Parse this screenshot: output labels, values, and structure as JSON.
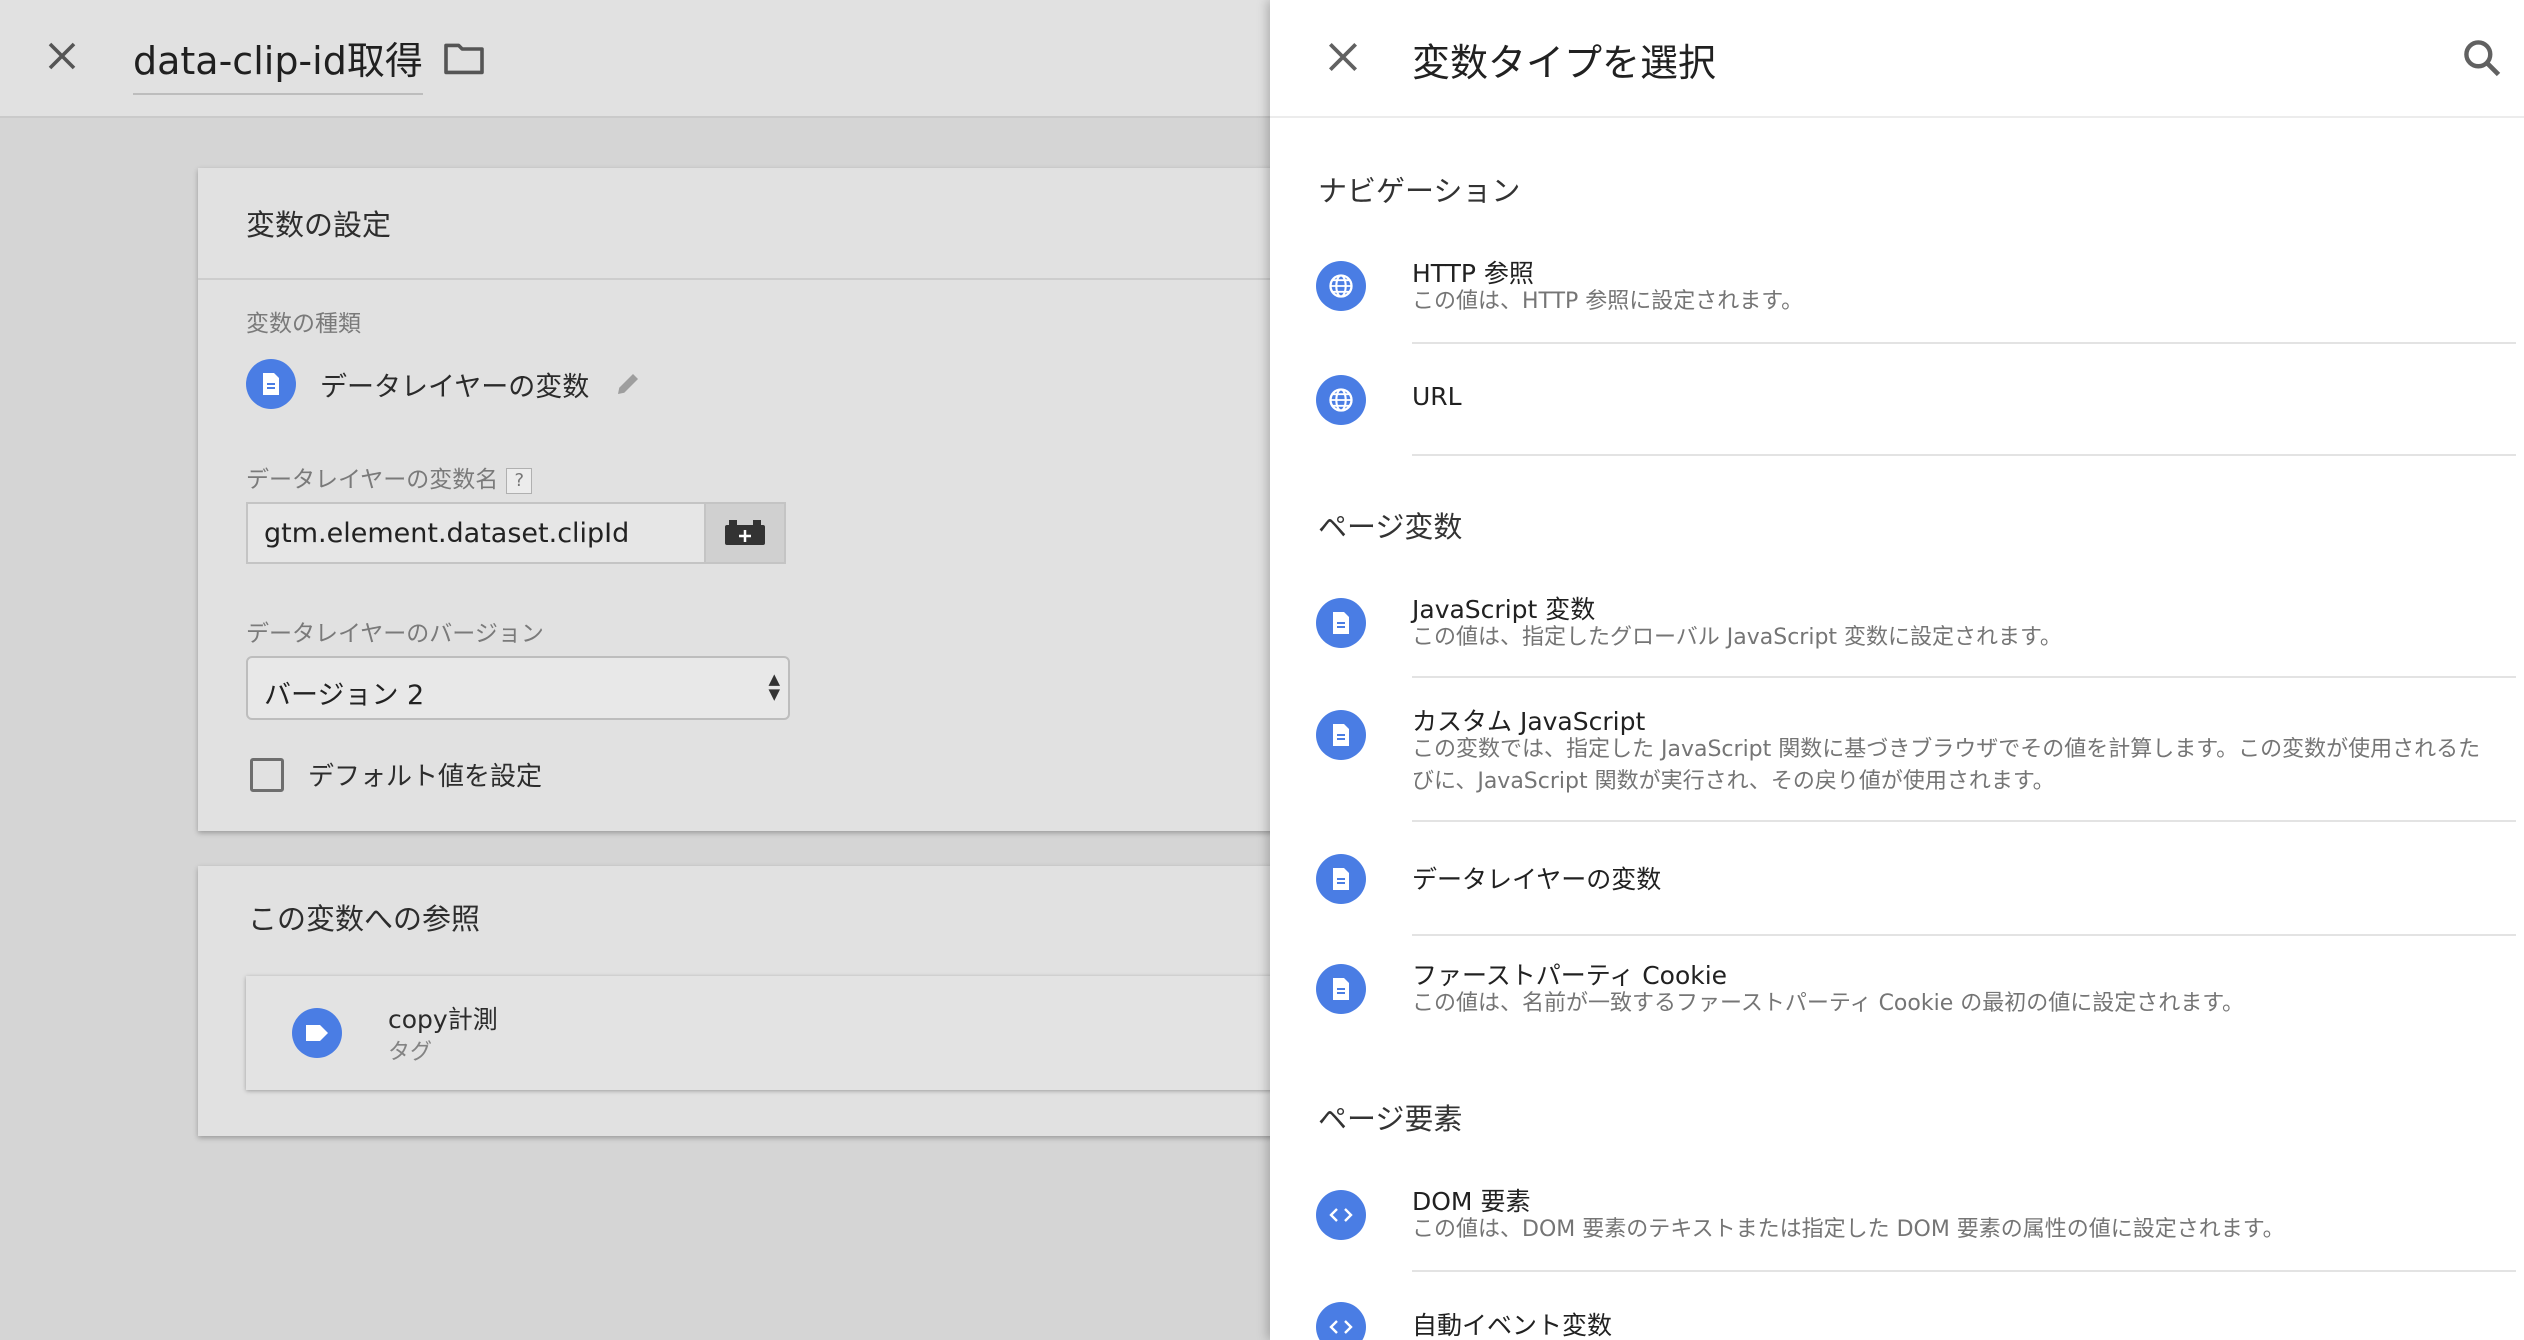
{
  "editor": {
    "title": "data-clip-id取得",
    "config_card": {
      "heading": "変数の設定",
      "type_label": "変数の種類",
      "type_value": "データレイヤーの変数",
      "name_label": "データレイヤーの変数名",
      "help_mark": "?",
      "name_value": "gtm.element.dataset.clipId",
      "version_label": "データレイヤーのバージョン",
      "version_value": "バージョン 2",
      "default_label": "デフォルト値を設定"
    },
    "refs_card": {
      "heading": "この変数への参照",
      "item_name": "copy計測",
      "item_type": "タグ"
    }
  },
  "panel": {
    "title": "変数タイプを選択",
    "sections": {
      "navigation": "ナビゲーション",
      "page_vars": "ページ変数",
      "page_elements": "ページ要素"
    },
    "items": {
      "http_referrer": {
        "title": "HTTP 参照",
        "desc": "この値は、HTTP 参照に設定されます。"
      },
      "url": {
        "title": "URL"
      },
      "js_variable": {
        "title": "JavaScript 変数",
        "desc": "この値は、指定したグローバル JavaScript 変数に設定されます。"
      },
      "custom_js": {
        "title": "カスタム JavaScript",
        "desc": "この変数では、指定した JavaScript 関数に基づきブラウザでその値を計算します。この変数が使用されるたびに、JavaScript 関数が実行され、その戻り値が使用されます。"
      },
      "data_layer": {
        "title": "データレイヤーの変数"
      },
      "first_party_cookie": {
        "title": "ファーストパーティ Cookie",
        "desc": "この値は、名前が一致するファーストパーティ Cookie の最初の値に設定されます。"
      },
      "dom_element": {
        "title": "DOM 要素",
        "desc": "この値は、DOM 要素のテキストまたは指定した DOM 要素の属性の値に設定されます。"
      },
      "auto_event": {
        "title": "自動イベント変数"
      }
    }
  },
  "colors": {
    "accent": "#4a7de4",
    "panel_bg": "#ffffff",
    "overlay_bg": "#d5d5d5"
  },
  "icons": {
    "close": "close-icon",
    "folder": "folder-icon",
    "document": "document-icon",
    "globe": "globe-icon",
    "code": "code-icon",
    "tag": "tag-icon",
    "pencil": "pencil-icon",
    "variable": "variable-icon",
    "search": "search-icon"
  }
}
